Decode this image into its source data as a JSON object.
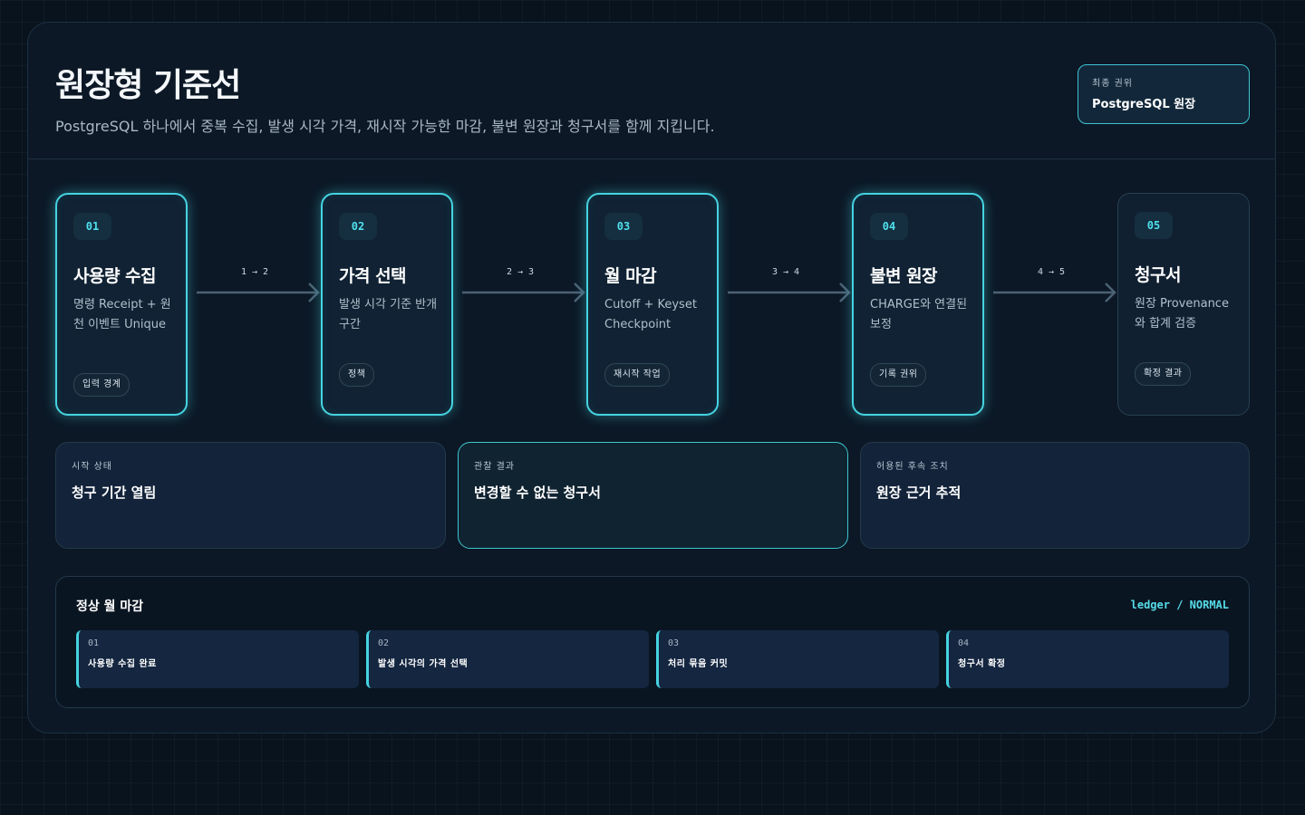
{
  "header": {
    "title": "원장형 기준선",
    "subtitle": "PostgreSQL 하나에서 중복 수집, 발생 시각 가격, 재시작 가능한 마감, 불변 원장과 청구서를 함께 지킵니다.",
    "authority_label": "최종 권위",
    "authority_value": "PostgreSQL 원장"
  },
  "stages": [
    {
      "num": "01",
      "name": "사용량 수집",
      "desc": "명령 Receipt + 원천 이벤트 Unique",
      "tag": "입력 경계",
      "highlighted": true
    },
    {
      "num": "02",
      "name": "가격 선택",
      "desc": "발생 시각 기준 반개구간",
      "tag": "정책",
      "highlighted": true
    },
    {
      "num": "03",
      "name": "월 마감",
      "desc": "Cutoff + Keyset Checkpoint",
      "tag": "재시작 작업",
      "highlighted": true
    },
    {
      "num": "04",
      "name": "불변 원장",
      "desc": "CHARGE와 연결된 보정",
      "tag": "기록 권위",
      "highlighted": true
    },
    {
      "num": "05",
      "name": "청구서",
      "desc": "원장 Provenance와 합계 검증",
      "tag": "확정 결과",
      "highlighted": false
    }
  ],
  "connectors": [
    "1 → 2",
    "2 → 3",
    "3 → 4",
    "4 → 5"
  ],
  "states": [
    {
      "label": "시작 상태",
      "value": "청구 기간 열림"
    },
    {
      "label": "관찰 결과",
      "value": "변경할 수 없는 청구서"
    },
    {
      "label": "허용된 후속 조치",
      "value": "원장 근거 추적"
    }
  ],
  "timeline": {
    "title": "정상 월 마감",
    "mode": "ledger / NORMAL",
    "steps": [
      {
        "num": "01",
        "label": "사용량 수집 완료"
      },
      {
        "num": "02",
        "label": "발생 시각의 가격 선택"
      },
      {
        "num": "03",
        "label": "처리 묶음 커밋"
      },
      {
        "num": "04",
        "label": "청구서 확정"
      }
    ]
  },
  "colors": {
    "accent": "#45d3e0",
    "background": "#09131d",
    "panel": "#0c1826"
  }
}
